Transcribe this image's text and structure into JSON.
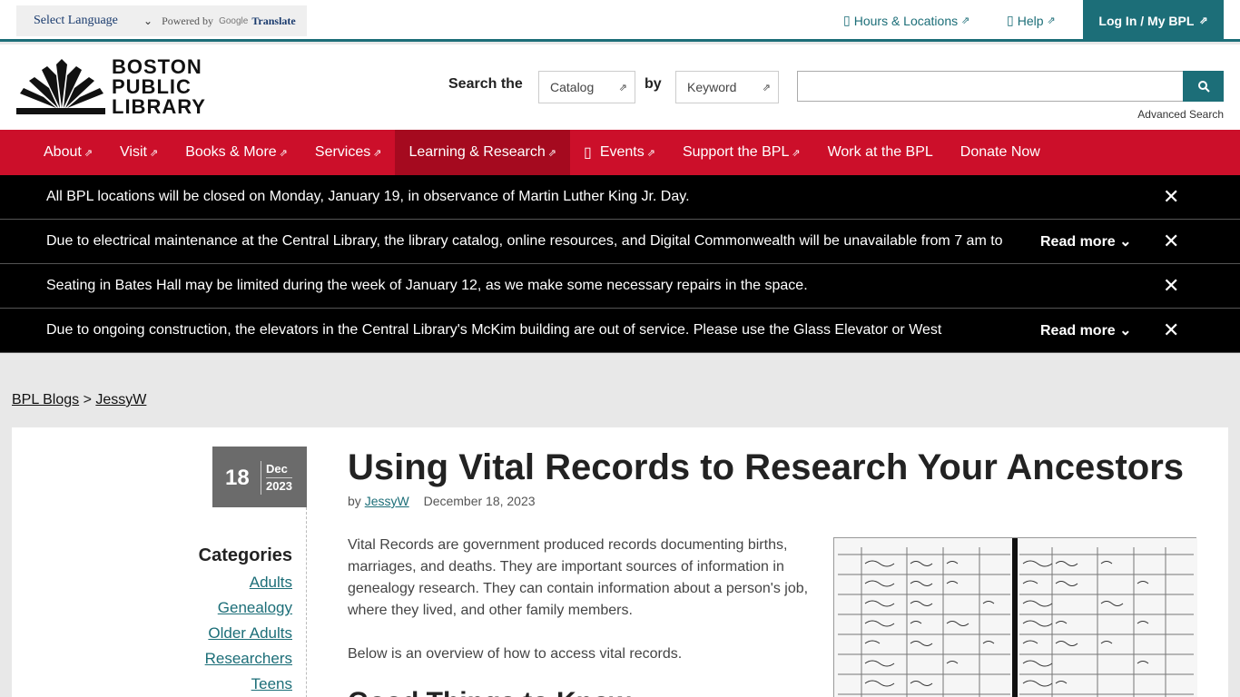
{
  "utility": {
    "language": "Select Language",
    "powered_by": "Powered by",
    "google": "Google",
    "translate": "Translate",
    "hours": "Hours & Locations",
    "help": "Help",
    "login": "Log In / My BPL"
  },
  "header": {
    "logo_lines": [
      "BOSTON",
      "PUBLIC",
      "LIBRARY"
    ],
    "search_the": "Search the",
    "catalog": "Catalog",
    "by": "by",
    "keyword": "Keyword",
    "search_value": "",
    "advanced": "Advanced Search"
  },
  "nav": [
    {
      "label": "About",
      "ext": true
    },
    {
      "label": "Visit",
      "ext": true
    },
    {
      "label": "Books & More",
      "ext": true
    },
    {
      "label": "Services",
      "ext": true
    },
    {
      "label": "Learning & Research",
      "ext": true
    },
    {
      "label": "Events",
      "ext": true
    },
    {
      "label": "Support the BPL",
      "ext": true
    },
    {
      "label": "Work at the BPL",
      "ext": false
    },
    {
      "label": "Donate Now",
      "ext": false
    }
  ],
  "alerts": [
    {
      "text": "All BPL locations will be closed on Monday, January 19, in observance of Martin Luther King Jr. Day.",
      "read_more": ""
    },
    {
      "text": "Due to electrical maintenance at the Central Library, the library catalog, online resources, and Digital Commonwealth will be unavailable from 7 am to",
      "read_more": "Read more"
    },
    {
      "text": "Seating in Bates Hall may be limited during the week of January 12, as we make some necessary repairs in the space.",
      "read_more": ""
    },
    {
      "text": "Due to ongoing construction, the elevators in the Central Library's McKim building are out of service. Please use the Glass Elevator or West",
      "read_more": "Read more"
    }
  ],
  "breadcrumb": {
    "blogs": "BPL Blogs",
    "sep": ">",
    "author": "JessyW"
  },
  "post": {
    "day": "18",
    "month": "Dec",
    "year": "2023",
    "title": "Using Vital Records to Research Your Ancestors",
    "by": "by",
    "author": "JessyW",
    "date": "December 18, 2023",
    "para1": "Vital Records are government produced records documenting births, marriages, and deaths. They are important sources of information in genealogy research. They can contain information about a person's job, where they lived, and other family members.",
    "para2": "Below is an overview of how to access vital records.",
    "h2": "Good Things to Know"
  },
  "categories": {
    "title": "Categories",
    "items": [
      "Adults",
      "Genealogy",
      "Older Adults",
      "Researchers",
      "Teens"
    ]
  },
  "colors": {
    "teal": "#1c6e78",
    "red": "#cc0f2a",
    "black": "#000000"
  }
}
